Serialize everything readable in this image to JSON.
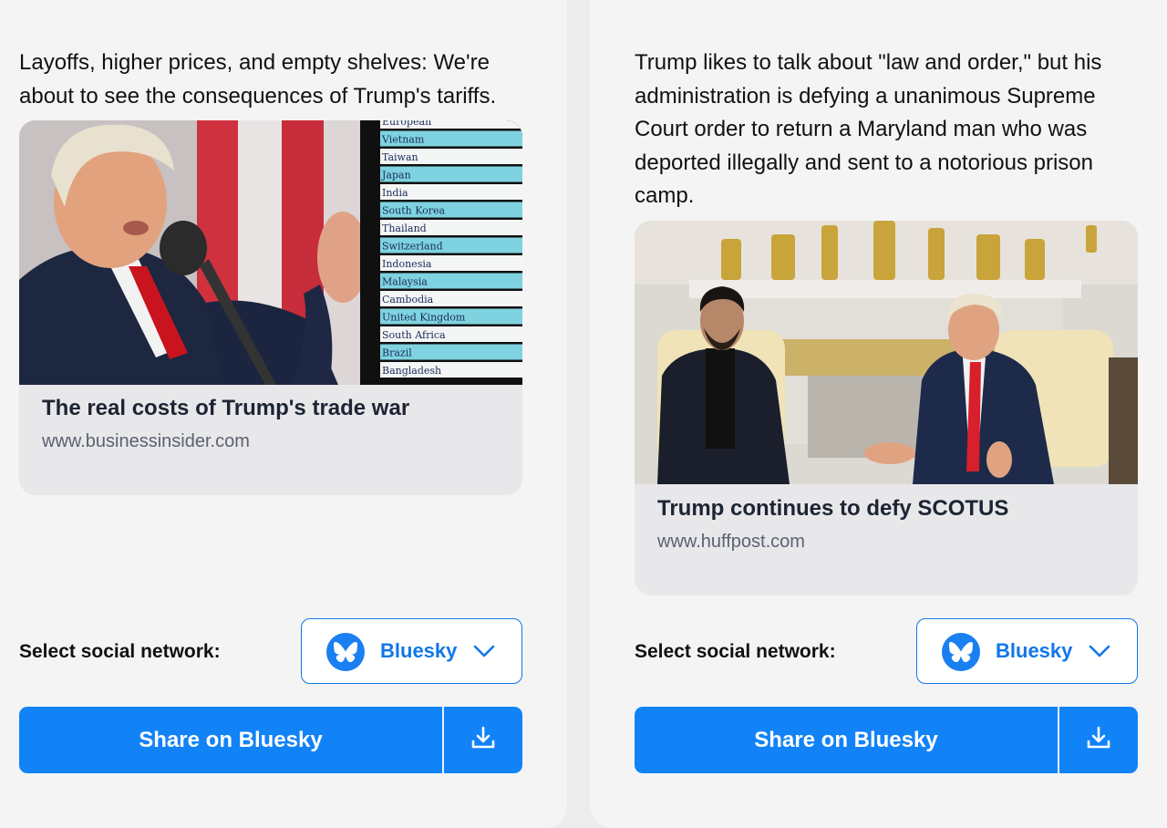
{
  "cards": [
    {
      "post_text": "Layoffs, higher prices, and empty shelves: We're about to see the consequences of Trump's tariffs.",
      "link": {
        "title": "The real costs of Trump's trade war",
        "domain": "www.businessinsider.com",
        "image_countries": [
          "European",
          "Vietnam",
          "Taiwan",
          "Japan",
          "India",
          "South Korea",
          "Thailand",
          "Switzerland",
          "Indonesia",
          "Malaysia",
          "Cambodia",
          "United Kingdom",
          "South Africa",
          "Brazil",
          "Bangladesh"
        ]
      },
      "select_label": "Select social network:",
      "network_selected": "Bluesky",
      "share_label": "Share on Bluesky"
    },
    {
      "post_text": "Trump likes to talk about \"law and order,\" but his administration is defying a unanimous Supreme Court order to return a Maryland man who was deported illegally and sent to a notorious prison camp.",
      "link": {
        "title": "Trump continues to defy SCOTUS",
        "domain": "www.huffpost.com"
      },
      "select_label": "Select social network:",
      "network_selected": "Bluesky",
      "share_label": "Share on Bluesky"
    }
  ],
  "icons": {
    "network_logo": "bluesky-butterfly-icon",
    "dropdown": "chevron-down-icon",
    "download": "download-icon"
  },
  "colors": {
    "accent": "#1283f7",
    "link_blue": "#1177e8",
    "card_bg": "#f4f4f4",
    "link_card_bg": "#e8e8ea"
  }
}
